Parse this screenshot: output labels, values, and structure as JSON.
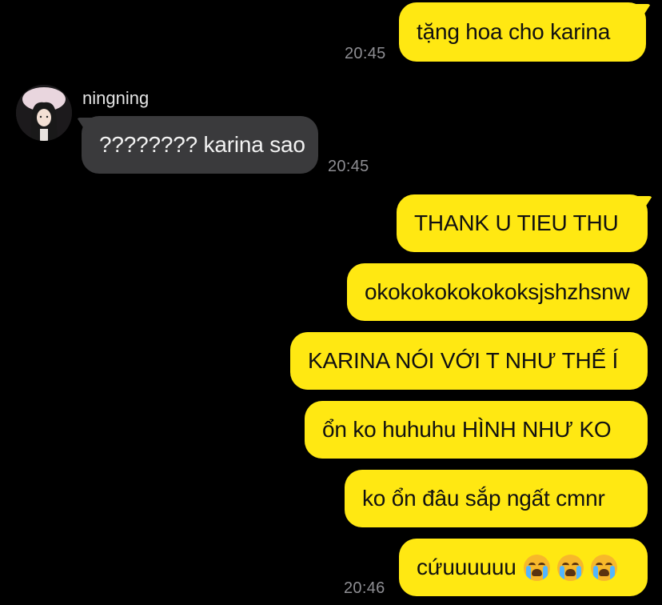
{
  "conversation": {
    "messages": [
      {
        "text": "tặng hoa cho karina"
      },
      {
        "text": "???????? karina sao"
      },
      {
        "text": "THANK U TIEU THU"
      },
      {
        "text": "okokokokokokoksjshzhsnw"
      },
      {
        "text": "KARINA NÓI VỚI T NHƯ THẾ Í"
      },
      {
        "text": "ổn ko huhuhu HÌNH NHƯ KO"
      },
      {
        "text": "ko ổn đâu sắp ngất cmnr"
      },
      {
        "text": "cứuuuuuu"
      }
    ],
    "timestamps": [
      "20:45",
      "20:45",
      "20:46"
    ],
    "contact": {
      "name": "ningning",
      "avatar_icon": "profile-photo"
    },
    "emoji_icon": "loudly-crying-face-icon",
    "colors": {
      "background": "#000000",
      "outgoing_bubble": "#ffe812",
      "incoming_bubble": "#3a3a3c",
      "timestamp": "#8e8e93"
    }
  }
}
